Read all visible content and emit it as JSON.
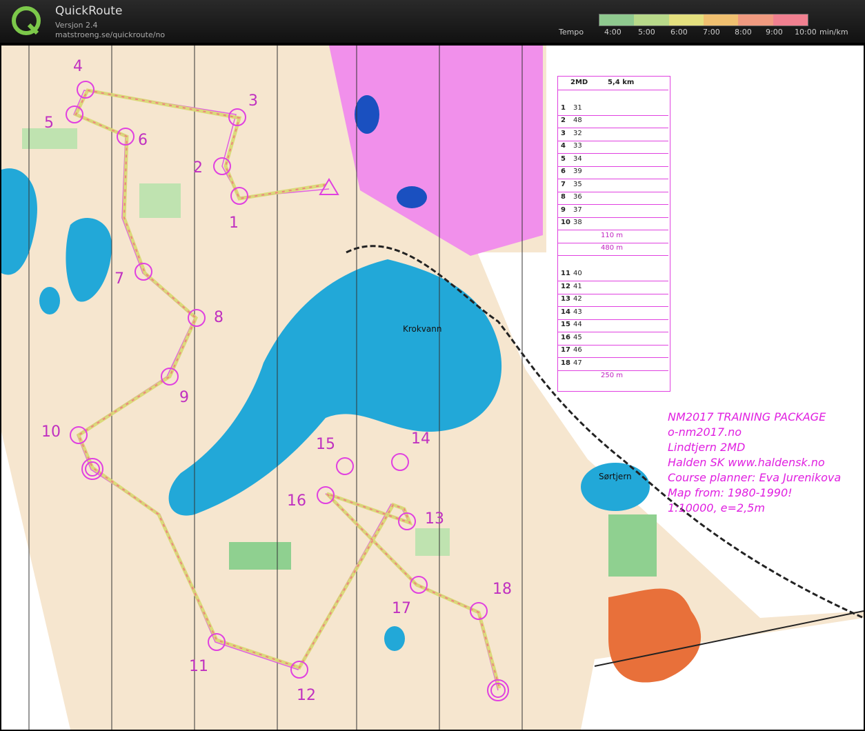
{
  "app": {
    "title": "QuickRoute",
    "version": "Versjon 2.4",
    "url": "matstroeng.se/quickroute/no"
  },
  "tempo": {
    "label": "Tempo",
    "ticks": [
      "4:00",
      "5:00",
      "6:00",
      "7:00",
      "8:00",
      "9:00",
      "10:00"
    ],
    "unit": "min/km",
    "colors": [
      "#8fc98f",
      "#b8d98a",
      "#e4e07e",
      "#f0c070",
      "#f09a80",
      "#f08090"
    ]
  },
  "map": {
    "lakes": [
      "Krokvann",
      "Sørtjern"
    ],
    "info_lines": [
      "NM2017 TRAINING PACKAGE",
      "o-nm2017.no",
      "Lindtjern 2MD",
      "Halden SK www.haldensk.no",
      "Course planner: Eva Jurenikova",
      "Map from: 1980-1990!",
      "1:10000, e=2,5m"
    ],
    "controls": [
      "1",
      "2",
      "3",
      "4",
      "5",
      "6",
      "7",
      "8",
      "9",
      "10",
      "11",
      "12",
      "13",
      "14",
      "15",
      "16",
      "17",
      "18"
    ],
    "colors": {
      "water": "#22a8d8",
      "route": "#e070e0",
      "track": "#c8d060",
      "forbidden": "#e060e0",
      "marsh": "#f07030"
    }
  },
  "description": {
    "course": "2MD",
    "length": "5,4 km",
    "rows": [
      {
        "num": "1",
        "code": "31"
      },
      {
        "num": "2",
        "code": "48"
      },
      {
        "num": "3",
        "code": "32"
      },
      {
        "num": "4",
        "code": "33"
      },
      {
        "num": "5",
        "code": "34"
      },
      {
        "num": "6",
        "code": "39"
      },
      {
        "num": "7",
        "code": "35"
      },
      {
        "num": "8",
        "code": "36"
      },
      {
        "num": "9",
        "code": "37"
      },
      {
        "num": "10",
        "code": "38"
      }
    ],
    "leg1": "110 m",
    "leg2": "480 m",
    "rows2": [
      {
        "num": "11",
        "code": "40"
      },
      {
        "num": "12",
        "code": "41"
      },
      {
        "num": "13",
        "code": "42"
      },
      {
        "num": "14",
        "code": "43"
      },
      {
        "num": "15",
        "code": "44"
      },
      {
        "num": "16",
        "code": "45"
      },
      {
        "num": "17",
        "code": "46"
      },
      {
        "num": "18",
        "code": "47"
      }
    ],
    "leg3": "250 m"
  }
}
